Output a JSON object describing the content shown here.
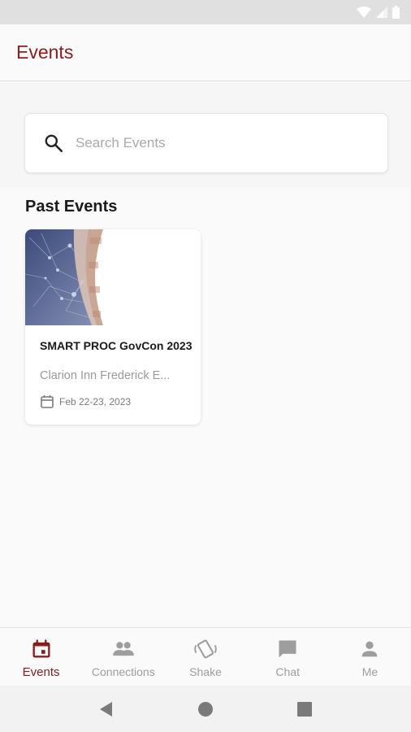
{
  "app": {
    "title": "Events"
  },
  "search": {
    "placeholder": "Search Events",
    "value": ""
  },
  "past_events": {
    "heading": "Past Events",
    "items": [
      {
        "name": "SMART PROC GovCon 2023",
        "venue": "Clarion Inn Frederick E...",
        "date": "Feb 22-23, 2023"
      }
    ]
  },
  "bottom_nav": {
    "items": [
      {
        "label": "Events",
        "icon": "calendar-icon",
        "active": true
      },
      {
        "label": "Connections",
        "icon": "people-icon",
        "active": false
      },
      {
        "label": "Shake",
        "icon": "shake-phone-icon",
        "active": false
      },
      {
        "label": "Chat",
        "icon": "chat-bubble-icon",
        "active": false
      },
      {
        "label": "Me",
        "icon": "person-icon",
        "active": false
      }
    ]
  },
  "colors": {
    "accent": "#8a1c1c",
    "inactive": "#9e9e9e",
    "background": "#fafafa"
  }
}
